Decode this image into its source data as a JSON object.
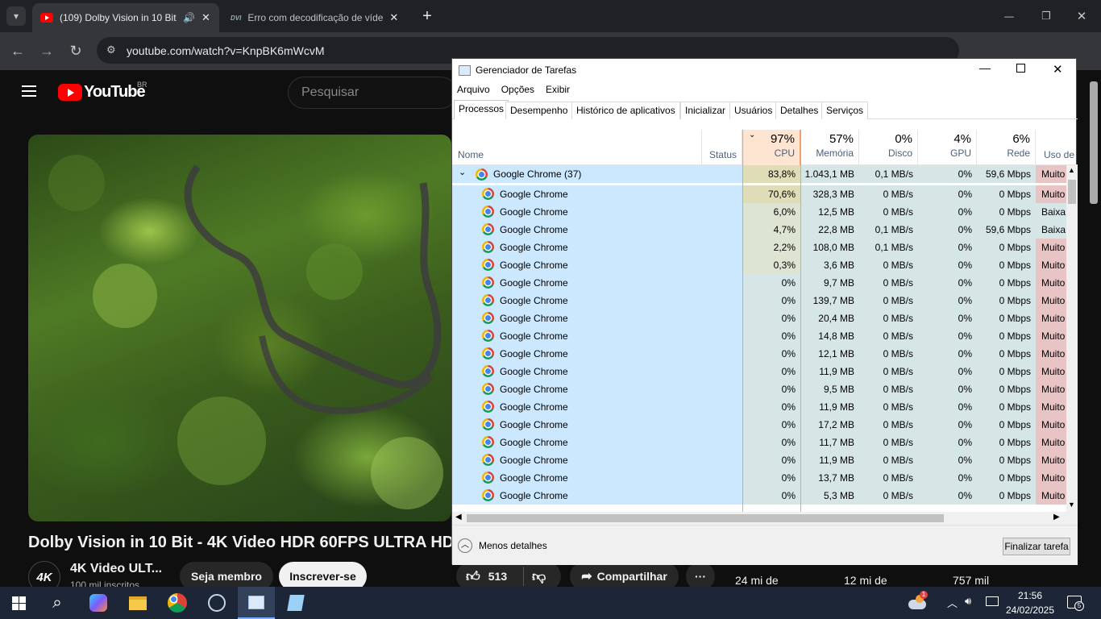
{
  "browser": {
    "tabs": [
      {
        "title": "(109) Dolby Vision in 10 Bit",
        "audio": "🔊",
        "close": "✕"
      },
      {
        "title": "Erro com decodificação de víde",
        "close": "✕"
      }
    ],
    "new_tab": "+",
    "tab_search": "⌄",
    "url": "youtube.com/watch?v=KnpBK6mWcvM",
    "window_controls": {
      "minimize": "—",
      "restore": "❐",
      "close": "✕"
    }
  },
  "youtube": {
    "logo": "YouTube",
    "region": "BR",
    "search_placeholder": "Pesquisar",
    "video_title": "Dolby Vision in 10 Bit - 4K Video HDR 60FPS ULTRA HD",
    "channel_avatar": "4K",
    "channel_name": "4K Video ULT...",
    "subscribers": "100 mil inscritos",
    "join": "Seja membro",
    "subscribe": "Inscrever-se",
    "likes": "513",
    "share": "Compartilhar",
    "more": "···",
    "side_meta": [
      "24 mi de",
      "12 mi de",
      "757 mil"
    ]
  },
  "taskmgr": {
    "title": "Gerenciador de Tarefas",
    "menu": [
      "Arquivo",
      "Opções",
      "Exibir"
    ],
    "tabs": [
      "Processos",
      "Desempenho",
      "Histórico de aplicativos",
      "Inicializar",
      "Usuários",
      "Detalhes",
      "Serviços"
    ],
    "columns": {
      "name": "Nome",
      "status": "Status",
      "cpu": {
        "pct": "97%",
        "label": "CPU"
      },
      "mem": {
        "pct": "57%",
        "label": "Memória"
      },
      "disk": {
        "pct": "0%",
        "label": "Disco"
      },
      "gpu": {
        "pct": "4%",
        "label": "GPU"
      },
      "net": {
        "pct": "6%",
        "label": "Rede"
      },
      "power": "Uso de e"
    },
    "group": {
      "name": "Google Chrome (37)",
      "cpu": "83,8%",
      "mem": "1.043,1 MB",
      "disk": "0,1 MB/s",
      "gpu": "0%",
      "net": "59,6 Mbps",
      "power": "Muito"
    },
    "rows": [
      {
        "name": "Google Chrome",
        "cpu": "70,6%",
        "mem": "328,3 MB",
        "disk": "0 MB/s",
        "gpu": "0%",
        "net": "0 Mbps",
        "power": "Muito"
      },
      {
        "name": "Google Chrome",
        "cpu": "6,0%",
        "mem": "12,5 MB",
        "disk": "0 MB/s",
        "gpu": "0%",
        "net": "0 Mbps",
        "power": "Baixa"
      },
      {
        "name": "Google Chrome",
        "cpu": "4,7%",
        "mem": "22,8 MB",
        "disk": "0,1 MB/s",
        "gpu": "0%",
        "net": "59,6 Mbps",
        "power": "Baixa"
      },
      {
        "name": "Google Chrome",
        "cpu": "2,2%",
        "mem": "108,0 MB",
        "disk": "0,1 MB/s",
        "gpu": "0%",
        "net": "0 Mbps",
        "power": "Muito"
      },
      {
        "name": "Google Chrome",
        "cpu": "0,3%",
        "mem": "3,6 MB",
        "disk": "0 MB/s",
        "gpu": "0%",
        "net": "0 Mbps",
        "power": "Muito"
      },
      {
        "name": "Google Chrome",
        "cpu": "0%",
        "mem": "9,7 MB",
        "disk": "0 MB/s",
        "gpu": "0%",
        "net": "0 Mbps",
        "power": "Muito"
      },
      {
        "name": "Google Chrome",
        "cpu": "0%",
        "mem": "139,7 MB",
        "disk": "0 MB/s",
        "gpu": "0%",
        "net": "0 Mbps",
        "power": "Muito"
      },
      {
        "name": "Google Chrome",
        "cpu": "0%",
        "mem": "20,4 MB",
        "disk": "0 MB/s",
        "gpu": "0%",
        "net": "0 Mbps",
        "power": "Muito"
      },
      {
        "name": "Google Chrome",
        "cpu": "0%",
        "mem": "14,8 MB",
        "disk": "0 MB/s",
        "gpu": "0%",
        "net": "0 Mbps",
        "power": "Muito"
      },
      {
        "name": "Google Chrome",
        "cpu": "0%",
        "mem": "12,1 MB",
        "disk": "0 MB/s",
        "gpu": "0%",
        "net": "0 Mbps",
        "power": "Muito"
      },
      {
        "name": "Google Chrome",
        "cpu": "0%",
        "mem": "11,9 MB",
        "disk": "0 MB/s",
        "gpu": "0%",
        "net": "0 Mbps",
        "power": "Muito"
      },
      {
        "name": "Google Chrome",
        "cpu": "0%",
        "mem": "9,5 MB",
        "disk": "0 MB/s",
        "gpu": "0%",
        "net": "0 Mbps",
        "power": "Muito"
      },
      {
        "name": "Google Chrome",
        "cpu": "0%",
        "mem": "11,9 MB",
        "disk": "0 MB/s",
        "gpu": "0%",
        "net": "0 Mbps",
        "power": "Muito"
      },
      {
        "name": "Google Chrome",
        "cpu": "0%",
        "mem": "17,2 MB",
        "disk": "0 MB/s",
        "gpu": "0%",
        "net": "0 Mbps",
        "power": "Muito"
      },
      {
        "name": "Google Chrome",
        "cpu": "0%",
        "mem": "11,7 MB",
        "disk": "0 MB/s",
        "gpu": "0%",
        "net": "0 Mbps",
        "power": "Muito"
      },
      {
        "name": "Google Chrome",
        "cpu": "0%",
        "mem": "11,9 MB",
        "disk": "0 MB/s",
        "gpu": "0%",
        "net": "0 Mbps",
        "power": "Muito"
      },
      {
        "name": "Google Chrome",
        "cpu": "0%",
        "mem": "13,7 MB",
        "disk": "0 MB/s",
        "gpu": "0%",
        "net": "0 Mbps",
        "power": "Muito"
      },
      {
        "name": "Google Chrome",
        "cpu": "0%",
        "mem": "5,3 MB",
        "disk": "0 MB/s",
        "gpu": "0%",
        "net": "0 Mbps",
        "power": "Muito"
      }
    ],
    "less_details": "Menos detalhes",
    "end_task": "Finalizar tarefa"
  },
  "taskbar": {
    "time": "21:56",
    "date": "24/02/2025",
    "notifications": "5",
    "weather_badge": "1"
  }
}
